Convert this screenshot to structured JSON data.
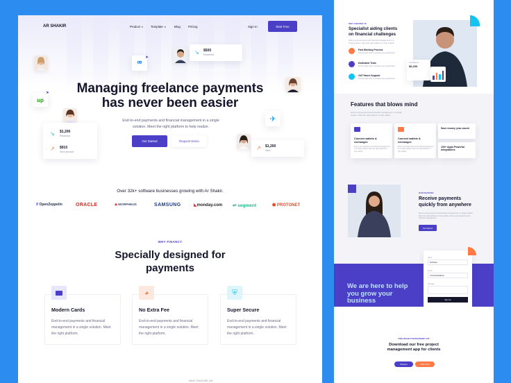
{
  "colors": {
    "accent": "#4b3fc7",
    "background": "#2d8cf0",
    "cyan": "#14c3ef",
    "orange": "#ff7a45",
    "green": "#3fb27f"
  },
  "header": {
    "brand": "AR SHAKIR",
    "nav": [
      "Product",
      "Template",
      "Blog",
      "Pricing"
    ],
    "sign_in": "Sign In",
    "start_free": "Start Free"
  },
  "hero": {
    "title_line1": "Managing freelance payments",
    "title_line2": "has never been easier",
    "subtitle": "End-to-end payments and financial management in a single solution. Meet the right platform to help realize.",
    "primary_button": "Get Started",
    "secondary_button": "Request Demo"
  },
  "floating_cards": {
    "received": {
      "amount": "$500",
      "label": "Received"
    },
    "left_received": {
      "amount": "$1,200",
      "label": "Received"
    },
    "left_sent": {
      "amount": "$910",
      "label": "Sent amount"
    },
    "right_sent": {
      "amount": "$1,200",
      "label": "Sent"
    }
  },
  "trust": {
    "text": "Over 32k+ software businesses growing with Ar Shakir.",
    "logos": [
      "OpenZeppelin",
      "ORACLE",
      "MORPHEUS",
      "SAMSUNG",
      "monday.com",
      "segment",
      "PROTONET"
    ]
  },
  "why": {
    "eyebrow": "WHY FINANCY",
    "title_line1": "Specially designed for",
    "title_line2": "payments",
    "features": [
      {
        "title": "Modern Cards",
        "desc": "End-to-end payments and financial management in a single solution. Meet the right platform.",
        "icon": "card-icon"
      },
      {
        "title": "No Extra Fee",
        "desc": "End-to-end payments and financial management in a single solution. Meet the right platform.",
        "icon": "pie-chart-icon"
      },
      {
        "title": "Super Secure",
        "desc": "End-to-end payments and financial management in a single solution. Meet the right platform.",
        "icon": "shield-icon"
      }
    ]
  },
  "footer_hint": "WHY CHOOSE US",
  "side": {
    "eyebrow": "WHY CHOOSE US",
    "title": "Specialist aiding clients on financial challenges",
    "desc": "End-to-end payments and financial management in a single solution. Meet the right platform to help realize.",
    "list": [
      {
        "title": "Fast Working Process",
        "desc": "Get the right tools to achieve your goals faster."
      },
      {
        "title": "Dedicated Team",
        "desc": "Get the right tools to achieve your goals faster."
      },
      {
        "title": "24/7 Hours Support",
        "desc": "Get the right tools to achieve your goals faster."
      }
    ],
    "balance": {
      "label": "Total Balance",
      "amount": "$6,200"
    },
    "features_title": "Features that blows mind",
    "features_desc": "End-to-end payments and financial management in a single solution. Meet the right platform to help realize.",
    "feature_cards": [
      {
        "title": "Connect wallets & exchanges",
        "desc": "End-to-end payments and financial management in a single solution. Meet the right platform to help realize."
      },
      {
        "title": "Connect wallets & exchanges",
        "desc": "End-to-end payments and financial management in a single solution. Meet the right platform to help realize."
      }
    ],
    "mini_stats": [
      "Save money year-round",
      "100+ Apps Powerful integrations"
    ],
    "receive_eyebrow": "OUR FEATURE",
    "receive_title": "Receive payments quickly from anywhere",
    "receive_desc": "End-to-end payments and financial management in a single solution. Meet the right platform to help realize. End-to-end payments and financial management.",
    "receive_button": "Get Started",
    "help_title": "We are here to help you grow your business",
    "form": {
      "name_label": "Name",
      "name_value": "Full Name",
      "email_label": "Email",
      "email_value": "Your Email Address",
      "message_label": "Message",
      "submit": "Sign Up"
    },
    "download_eyebrow": "FREE PROJECT MANAGEMENT APP",
    "download_title": "Download our free project management app for clients",
    "download_buttons": [
      "Playstore",
      "Apple Store"
    ]
  }
}
